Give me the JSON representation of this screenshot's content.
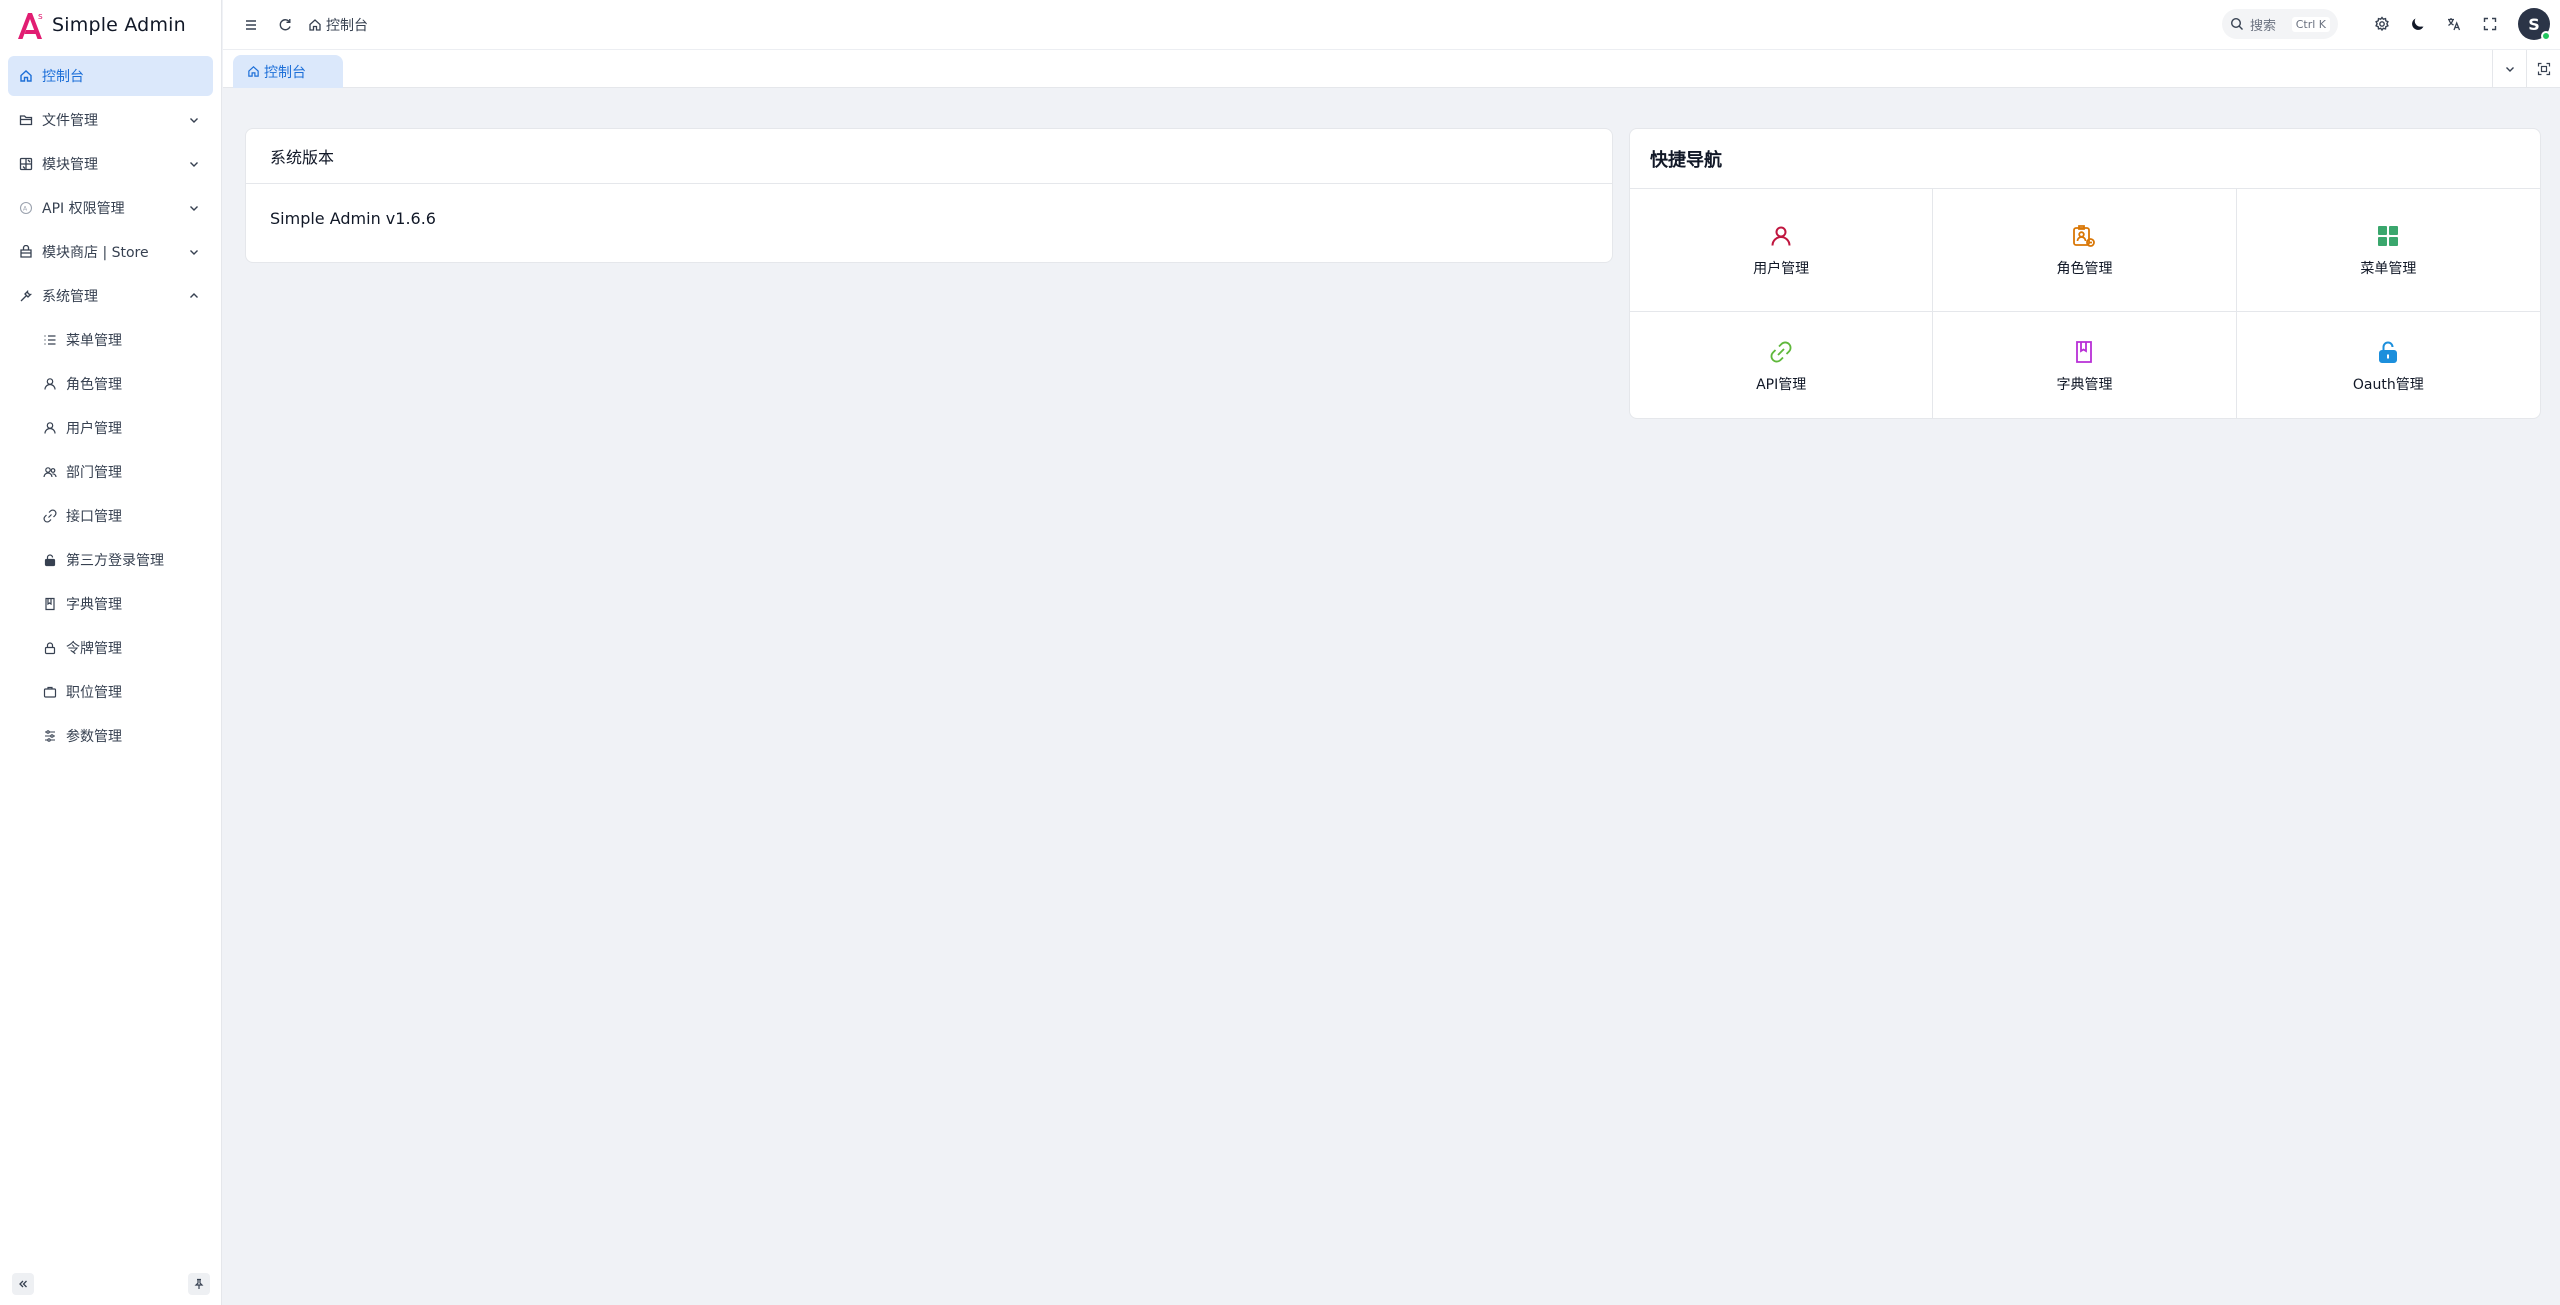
{
  "app": {
    "title": "Simple Admin"
  },
  "sidebar": {
    "items": [
      {
        "label": "控制台",
        "icon": "home-icon"
      },
      {
        "label": "文件管理",
        "icon": "folder-icon"
      },
      {
        "label": "模块管理",
        "icon": "module-icon"
      },
      {
        "label": "API 权限管理",
        "icon": "api-permission-icon"
      },
      {
        "label": "模块商店 | Store",
        "icon": "store-icon"
      },
      {
        "label": "系统管理",
        "icon": "tool-icon"
      }
    ],
    "system_children": [
      {
        "label": "菜单管理",
        "icon": "list-icon"
      },
      {
        "label": "角色管理",
        "icon": "user-icon"
      },
      {
        "label": "用户管理",
        "icon": "user-icon"
      },
      {
        "label": "部门管理",
        "icon": "users-icon"
      },
      {
        "label": "接口管理",
        "icon": "link-icon"
      },
      {
        "label": "第三方登录管理",
        "icon": "unlock-icon"
      },
      {
        "label": "字典管理",
        "icon": "book-icon"
      },
      {
        "label": "令牌管理",
        "icon": "lock-icon"
      },
      {
        "label": "职位管理",
        "icon": "briefcase-icon"
      },
      {
        "label": "参数管理",
        "icon": "params-icon"
      }
    ]
  },
  "header": {
    "breadcrumb": "控制台",
    "search": {
      "label": "搜索",
      "shortcut": "Ctrl K"
    },
    "avatar_letter": "S"
  },
  "tabs": [
    {
      "label": "控制台"
    }
  ],
  "version_card": {
    "title": "系统版本",
    "value": "Simple Admin v1.6.6"
  },
  "quick_nav": {
    "title": "快捷导航",
    "items": [
      {
        "label": "用户管理",
        "icon": "user-icon",
        "color": "#c0163f"
      },
      {
        "label": "角色管理",
        "icon": "role-badge-icon",
        "color": "#d97706"
      },
      {
        "label": "菜单管理",
        "icon": "grid-icon",
        "color": "#3aa76d"
      },
      {
        "label": "API管理",
        "icon": "link-icon",
        "color": "#5fb83b"
      },
      {
        "label": "字典管理",
        "icon": "book-icon",
        "color": "#b82fd6"
      },
      {
        "label": "Oauth管理",
        "icon": "unlock-icon",
        "color": "#1c8fdc"
      }
    ]
  },
  "colors": {
    "primary": "#1d6fd8",
    "active_bg": "#dbe8fb",
    "logo": "#e11d72"
  }
}
